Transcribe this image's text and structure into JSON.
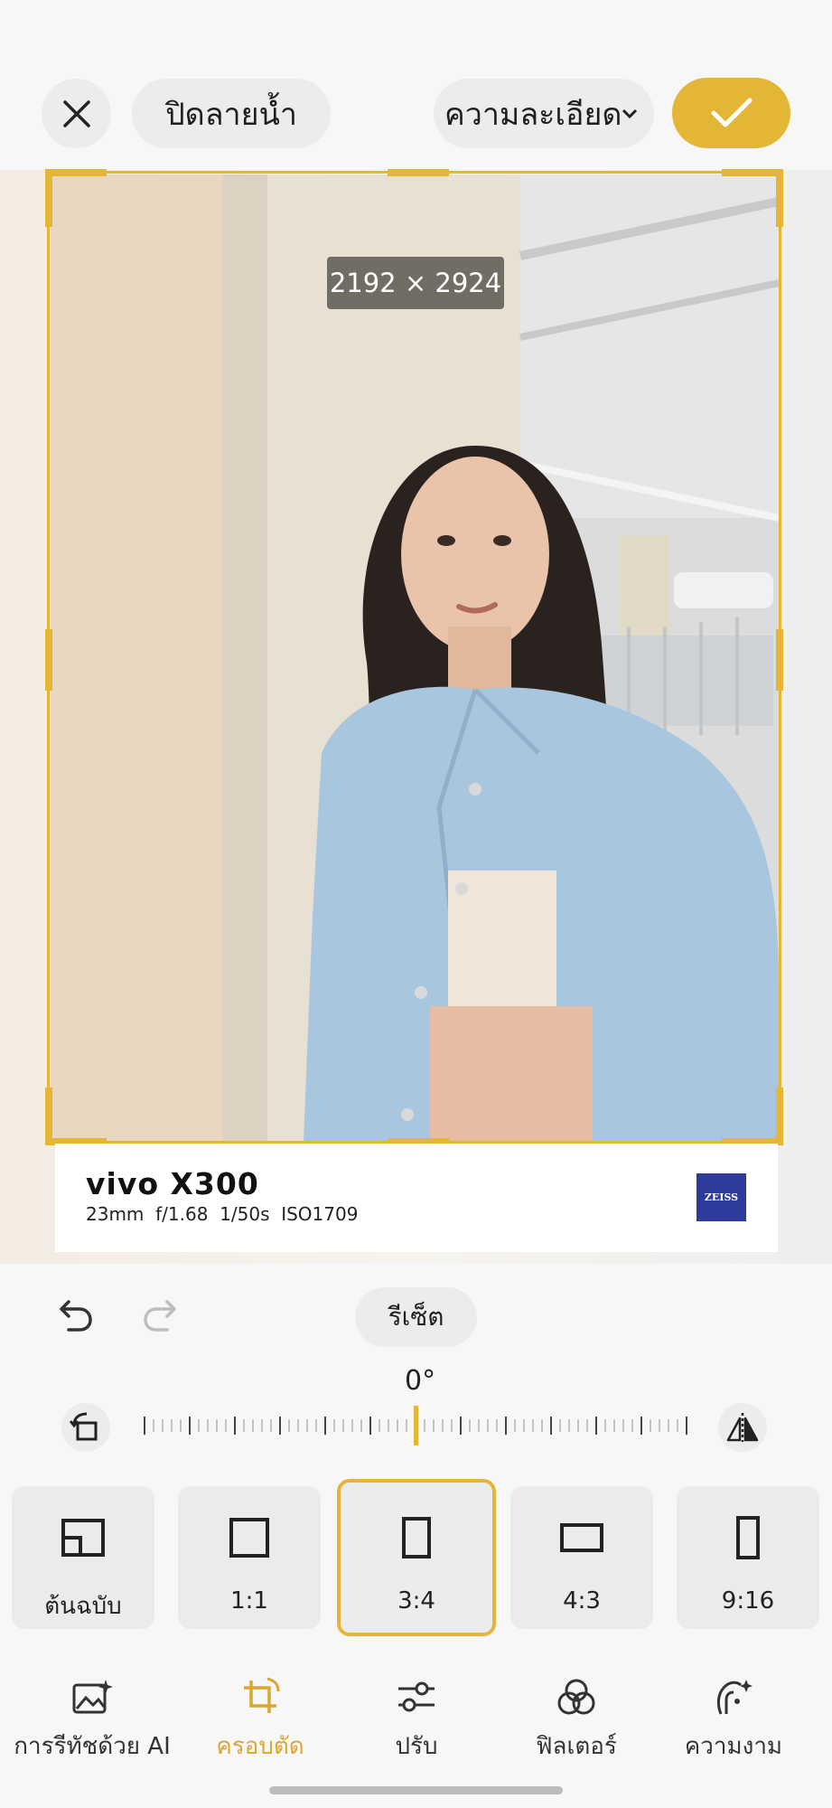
{
  "top_bar": {
    "watermark_label": "ปิดลายน้ำ",
    "resolution_label": "ความละเอียด"
  },
  "photo": {
    "dimensions": "2192 × 2924"
  },
  "watermark": {
    "model": "vivo X300",
    "exif": "23mm  f/1.68  1/50s  ISO1709",
    "brand_logo": "ZEISS"
  },
  "editor": {
    "reset_label": "รีเซ็ต",
    "angle": "0°"
  },
  "ratios": [
    {
      "label": "ต้นฉบับ",
      "icon": "original-ratio-icon"
    },
    {
      "label": "1:1",
      "icon": "square-ratio-icon"
    },
    {
      "label": "3:4",
      "icon": "portrait-ratio-icon",
      "selected": true
    },
    {
      "label": "4:3",
      "icon": "landscape-ratio-icon"
    },
    {
      "label": "9:16",
      "icon": "tall-ratio-icon"
    }
  ],
  "nav": [
    {
      "label": "การรีทัชด้วย AI",
      "icon": "ai-retouch-icon"
    },
    {
      "label": "ครอบตัด",
      "icon": "crop-icon",
      "active": true
    },
    {
      "label": "ปรับ",
      "icon": "adjust-sliders-icon"
    },
    {
      "label": "ฟิลเตอร์",
      "icon": "filter-icon"
    },
    {
      "label": "ความงาม",
      "icon": "beauty-icon"
    }
  ],
  "colors": {
    "accent": "#e3b735",
    "active_text": "#d8a92e"
  }
}
